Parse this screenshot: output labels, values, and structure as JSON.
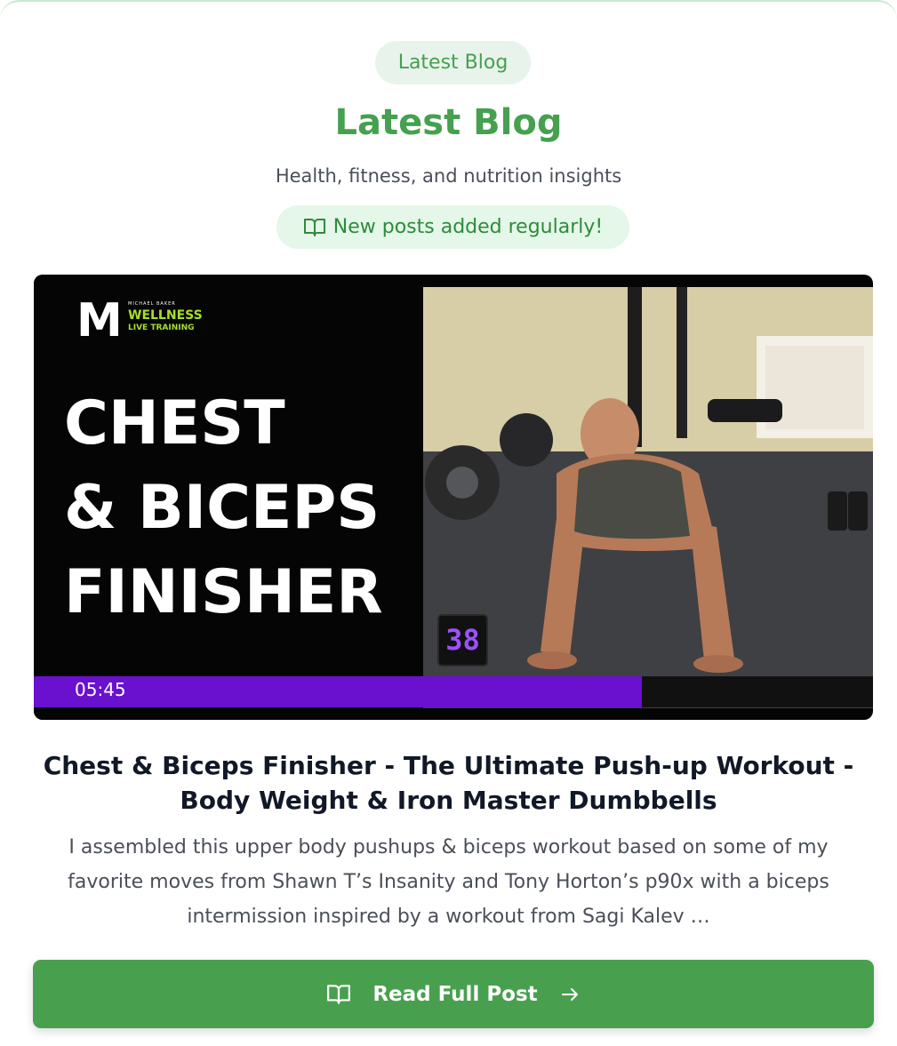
{
  "section": {
    "badge": "Latest Blog",
    "title": "Latest Blog",
    "subtitle": "Health, fitness, and nutrition insights",
    "notice": "New posts added regularly!",
    "notice_icon": "book-open-icon"
  },
  "post": {
    "thumbnail": {
      "logo_m": "M",
      "logo_small": "MICHAEL BAKER",
      "logo_wellness": "WELLNESS",
      "logo_live": "LIVE TRAINING",
      "headline_lines": [
        "CHEST",
        "& BICEPS",
        "FINISHER"
      ],
      "timestamp": "05:45",
      "counter": "38",
      "progress_fraction": 0.725,
      "progress_color": "#6a10cf"
    },
    "title_line1": "Chest & Biceps Finisher - The Ultimate Push-up Workout -",
    "title_line2": "Body Weight & Iron Master Dumbbells",
    "excerpt_line1": "I assembled this upper body pushups & biceps workout based on some of my",
    "excerpt_line2": "favorite moves from Shawn T’s Insanity and Tony Horton’s p90x with a biceps",
    "excerpt_line3": "intermission inspired by a workout from Sagi Kalev …"
  },
  "button": {
    "label": "Read Full Post",
    "left_icon": "book-open-icon",
    "right_icon": "arrow-right-icon"
  },
  "colors": {
    "accent": "#45a04f",
    "button": "#48a04f",
    "badge_bg": "#e8f4eb",
    "notice_bg": "#e4f7e8"
  }
}
